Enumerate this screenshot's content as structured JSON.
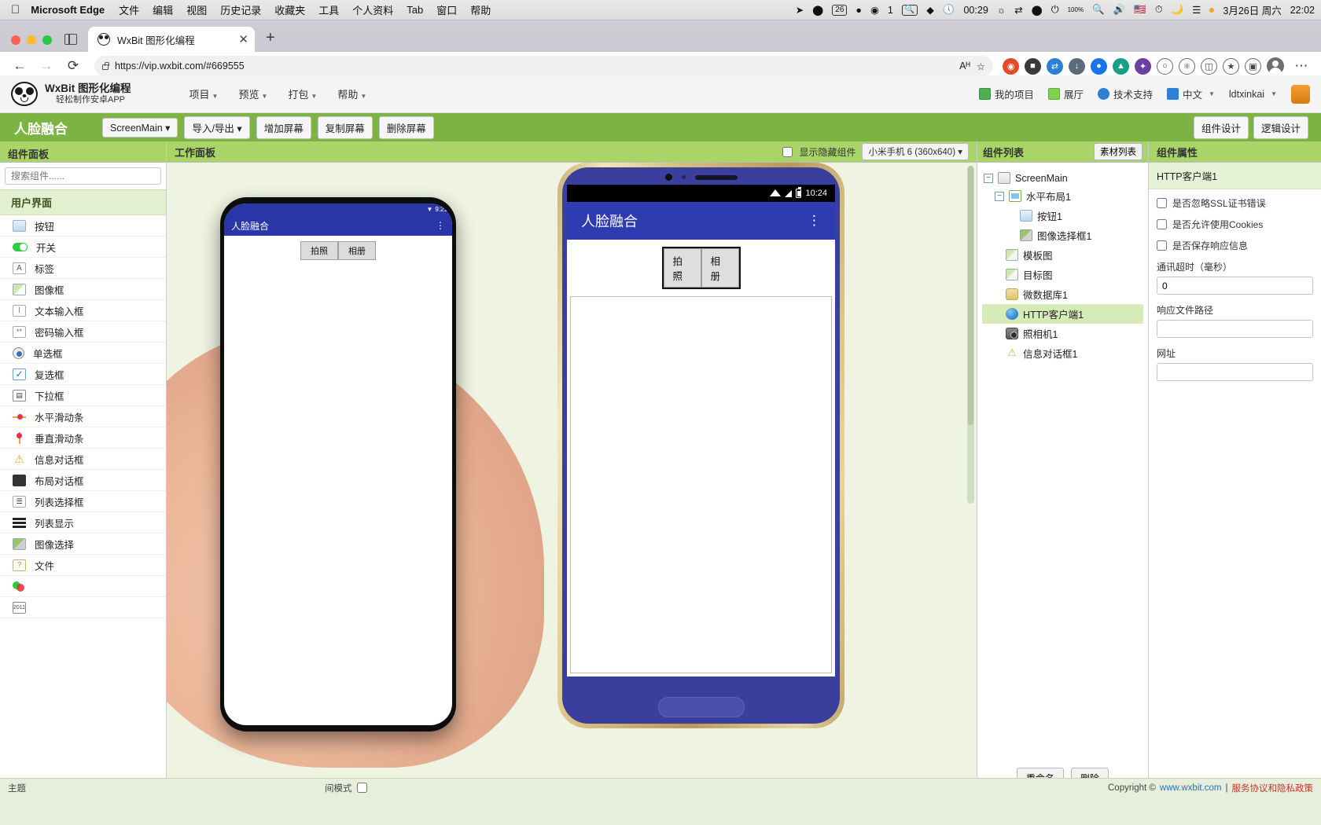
{
  "macbar": {
    "apple": "apple-logo",
    "app_name": "Microsoft Edge",
    "menus": [
      "文件",
      "编辑",
      "视图",
      "历史记录",
      "收藏夹",
      "工具",
      "个人资料",
      "Tab",
      "窗口",
      "帮助"
    ],
    "tray": {
      "badge_count": "26",
      "notif_count": "1",
      "clock": "00:29",
      "battery_pct": "100%",
      "date": "3月26日 周六",
      "time": "22:02"
    }
  },
  "browser": {
    "tab": {
      "title": "WxBit 图形化编程",
      "close": "✕"
    },
    "newtab": "+",
    "nav": {
      "back": "←",
      "forward": "→",
      "reload": "⟳"
    },
    "url": "https://vip.wxbit.com/#669555",
    "url_actions": {
      "read_aloud": "Aᴴ",
      "favorite": "☆"
    },
    "more": "⋯"
  },
  "app_header": {
    "brand_line1": "WxBit 图形化编程",
    "brand_line2": "轻松制作安卓APP",
    "menus": [
      {
        "label": "项目"
      },
      {
        "label": "预览"
      },
      {
        "label": "打包"
      },
      {
        "label": "帮助"
      }
    ],
    "right_items": [
      {
        "label": "我的项目",
        "icon": "list-icon"
      },
      {
        "label": "展厅",
        "icon": "grid-icon"
      },
      {
        "label": "技术支持",
        "icon": "support-icon"
      },
      {
        "label": "中文",
        "icon": "language-icon"
      },
      {
        "label": "ldtxinkai",
        "icon": "user-icon"
      }
    ]
  },
  "toolbar": {
    "project_title": "人脸融合",
    "screen_select": "ScreenMain",
    "import_export": "导入/导出",
    "add_screen": "增加屏幕",
    "copy_screen": "复制屏幕",
    "delete_screen": "删除屏幕",
    "component_design": "组件设计",
    "logic_design": "逻辑设计"
  },
  "left_panel": {
    "title": "组件面板",
    "search_placeholder": "搜索组件......",
    "group_title": "用户界面",
    "components": [
      {
        "label": "按钮",
        "icon": "button-icon"
      },
      {
        "label": "开关",
        "icon": "switch-icon"
      },
      {
        "label": "标签",
        "icon": "label-icon"
      },
      {
        "label": "图像框",
        "icon": "image-icon"
      },
      {
        "label": "文本输入框",
        "icon": "text-input-icon"
      },
      {
        "label": "密码输入框",
        "icon": "password-input-icon"
      },
      {
        "label": "单选框",
        "icon": "radio-icon"
      },
      {
        "label": "复选框",
        "icon": "checkbox-icon"
      },
      {
        "label": "下拉框",
        "icon": "dropdown-icon"
      },
      {
        "label": "水平滑动条",
        "icon": "horizontal-slider-icon"
      },
      {
        "label": "垂直滑动条",
        "icon": "vertical-slider-icon"
      },
      {
        "label": "信息对话框",
        "icon": "warning-dialog-icon"
      },
      {
        "label": "布局对话框",
        "icon": "layout-dialog-icon"
      },
      {
        "label": "列表选择框",
        "icon": "list-select-icon"
      },
      {
        "label": "列表显示",
        "icon": "list-display-icon"
      },
      {
        "label": "图像选择",
        "icon": "image-picker-icon"
      },
      {
        "label": "文件",
        "icon": "file-icon"
      },
      {
        "label": "",
        "icon": "color-picker-icon"
      },
      {
        "label": "",
        "icon": "date-picker-icon"
      }
    ],
    "bottom_label": "主题"
  },
  "workspace": {
    "title": "工作面板",
    "show_hidden_label": "显示隐藏组件",
    "device": "小米手机 6 (360x640)",
    "spacing_mode_label": "间模式"
  },
  "phone_preview": {
    "status_time": "10:24",
    "app_title": "人脸融合",
    "kebab": "⋮",
    "tab_camera": "拍照",
    "tab_album": "相册"
  },
  "photo_phone": {
    "app_title": "人脸融合",
    "status_time": "9:21",
    "kebab": "⋮",
    "tab_camera": "拍照",
    "tab_album": "相册"
  },
  "tree_panel": {
    "title": "组件列表",
    "material_list": "素材列表",
    "nodes": [
      {
        "label": "ScreenMain",
        "icon": "screen-icon",
        "indent": 0,
        "toggle": "−",
        "selected": false
      },
      {
        "label": "水平布局1",
        "icon": "horizontal-layout-icon",
        "indent": 1,
        "toggle": "−",
        "selected": false
      },
      {
        "label": "按钮1",
        "icon": "button-icon",
        "indent": 2,
        "toggle": "",
        "selected": false
      },
      {
        "label": "图像选择框1",
        "icon": "image-picker-icon",
        "indent": 2,
        "toggle": "",
        "selected": false
      },
      {
        "label": "模板图",
        "icon": "image-icon",
        "indent": 1,
        "toggle": "",
        "selected": false
      },
      {
        "label": "目标图",
        "icon": "image-icon",
        "indent": 1,
        "toggle": "",
        "selected": false
      },
      {
        "label": "微数据库1",
        "icon": "database-icon",
        "indent": 1,
        "toggle": "",
        "selected": false
      },
      {
        "label": "HTTP客户端1",
        "icon": "http-client-icon",
        "indent": 1,
        "toggle": "",
        "selected": true
      },
      {
        "label": "照相机1",
        "icon": "camera-icon",
        "indent": 1,
        "toggle": "",
        "selected": false
      },
      {
        "label": "信息对话框1",
        "icon": "warning-dialog-icon",
        "indent": 1,
        "toggle": "",
        "selected": false
      }
    ],
    "rename_button": "重命名",
    "delete_button": "删除"
  },
  "prop_panel": {
    "title": "组件属性",
    "component_name": "HTTP客户端1",
    "checkboxes": [
      {
        "label": "是否忽略SSL证书错误",
        "checked": false
      },
      {
        "label": "是否允许使用Cookies",
        "checked": false
      },
      {
        "label": "是否保存响应信息",
        "checked": false
      }
    ],
    "fields": [
      {
        "label": "通讯超时（毫秒）",
        "value": "0"
      },
      {
        "label": "响应文件路径",
        "value": ""
      },
      {
        "label": "网址",
        "value": ""
      }
    ]
  },
  "footer": {
    "copyright": "Copyright ©",
    "site": "www.wxbit.com",
    "sep": "|",
    "policy": "服务协议和隐私政策"
  },
  "colors": {
    "brand_green": "#7cb342",
    "panel_green": "#a9d468",
    "android_blue": "#2f3bb0",
    "selection": "#d7ebb8"
  }
}
